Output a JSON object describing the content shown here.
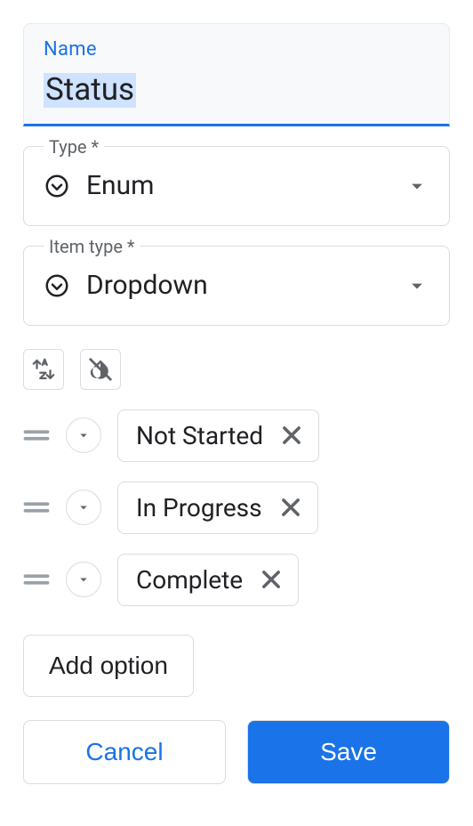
{
  "name": {
    "label": "Name",
    "value": "Status"
  },
  "type": {
    "label": "Type *",
    "value": "Enum"
  },
  "item_type": {
    "label": "Item type *",
    "value": "Dropdown"
  },
  "options": [
    {
      "label": "Not Started"
    },
    {
      "label": "In Progress"
    },
    {
      "label": "Complete"
    }
  ],
  "buttons": {
    "add_option": "Add option",
    "cancel": "Cancel",
    "save": "Save"
  }
}
